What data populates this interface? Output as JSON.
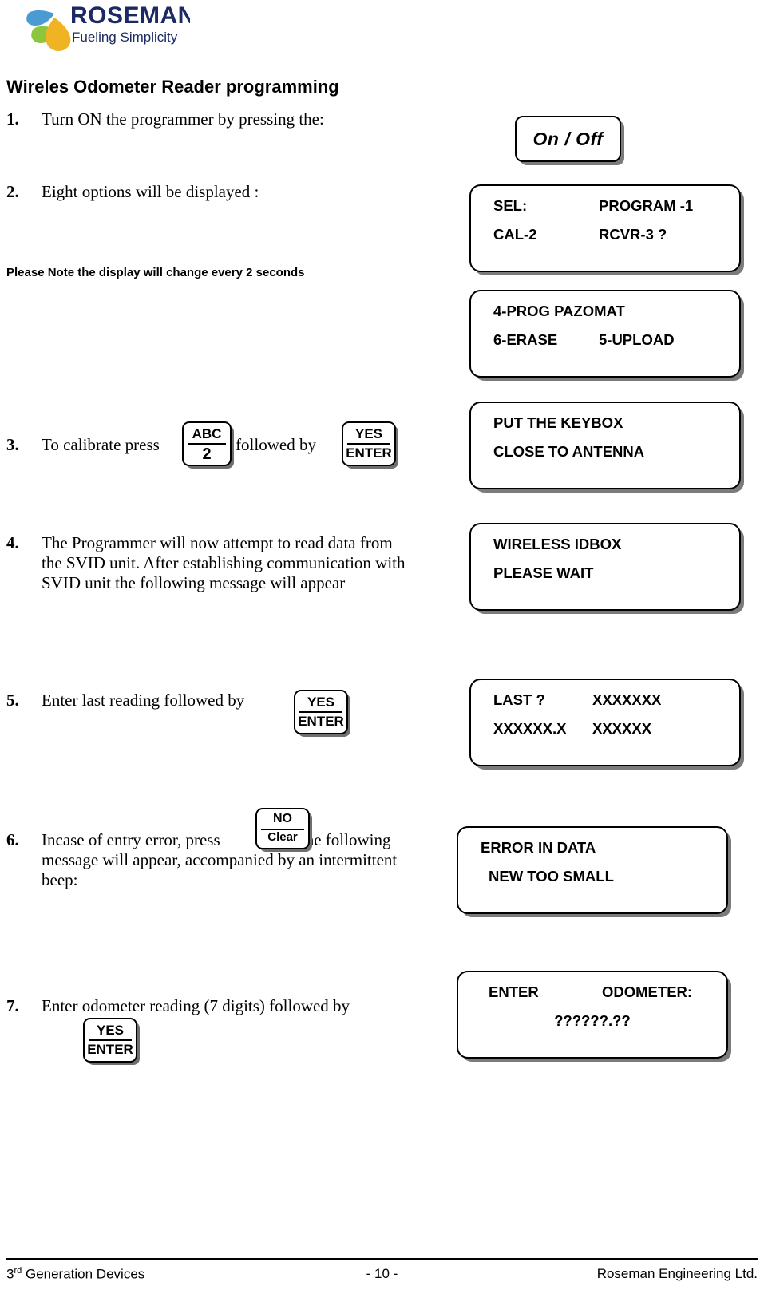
{
  "logo": {
    "brand": "ROSEMAN",
    "tagline": "Fueling Simplicity",
    "brand_color": "#1b2a63",
    "droplet_blue": "#4a9bd4",
    "droplet_green": "#8cc63f",
    "droplet_yellow": "#f0b323"
  },
  "headline": "Wireles Odometer Reader programming",
  "note": "Please Note the display will change every 2 seconds",
  "steps": {
    "s1": {
      "num": "1.",
      "text": "Turn ON the programmer by pressing the:"
    },
    "s2": {
      "num": "2.",
      "text": "Eight options will be displayed :"
    },
    "s3": {
      "num": "3.",
      "pre": "To calibrate press",
      "mid": "followed by"
    },
    "s4": {
      "num": "4.",
      "text": "The Programmer will now attempt to read data from the SVID unit.  After establishing communication with SVID unit the following message will appear"
    },
    "s5": {
      "num": "5.",
      "text": "Enter last reading followed by"
    },
    "s6": {
      "num": "6.",
      "pre": "Incase of entry error, press",
      "post": "the following message will appear, accompanied by an intermittent beep:"
    },
    "s7": {
      "num": "7.",
      "text": "Enter odometer reading (7 digits) followed  by"
    }
  },
  "keys": {
    "onoff": "On / Off",
    "abc2": {
      "top": "ABC",
      "bottom": "2"
    },
    "yes_enter": {
      "top": "YES",
      "bottom": "ENTER"
    },
    "no_clear": {
      "top": "NO",
      "bottom": "Clear"
    }
  },
  "displays": {
    "d1": {
      "line1_left": "SEL:",
      "line1_right": "PROGRAM -1",
      "line2_left": "CAL-2",
      "line2_right": "RCVR-3    ?"
    },
    "d2": {
      "line1_left": "4-PROG PAZOMAT",
      "line1_right": "",
      "line2_left": "6-ERASE",
      "line2_right": "5-UPLOAD"
    },
    "d3": {
      "line1_left": "PUT THE KEYBOX",
      "line1_right": "",
      "line2_left": "CLOSE TO ANTENNA",
      "line2_right": ""
    },
    "d4": {
      "line1_left": "WIRELESS IDBOX",
      "line1_right": "",
      "line2_left": "PLEASE WAIT",
      "line2_right": ""
    },
    "d5": {
      "line1_left": "LAST  ?",
      "line1_right": "XXXXXXX",
      "line2_left": "XXXXXX.X",
      "line2_right": "XXXXXX"
    },
    "d6": {
      "line1_left": "ERROR IN DATA",
      "line1_right": "",
      "line2_left": "NEW TOO SMALL",
      "line2_right": ""
    },
    "d7": {
      "line1_left": "ENTER",
      "line1_right": "ODOMETER:",
      "line2_center": "??????.??"
    }
  },
  "footer": {
    "left_prefix": "3",
    "left_sup": "rd",
    "left_rest": " Generation Devices",
    "center": "- 10 -",
    "right": "Roseman Engineering Ltd."
  }
}
